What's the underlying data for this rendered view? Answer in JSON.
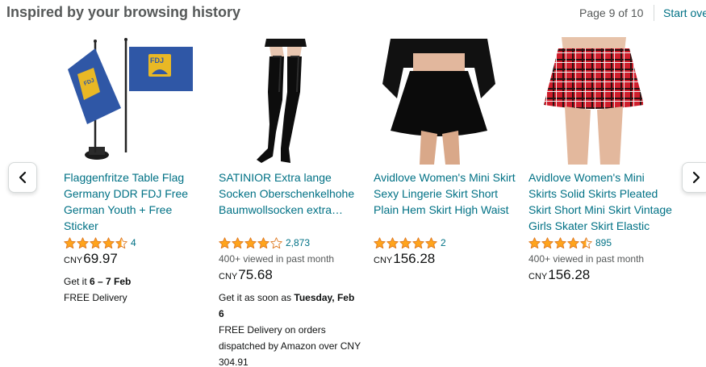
{
  "header": {
    "title": "Inspired by your browsing history",
    "page_indicator": "Page 9 of 10",
    "start_over": "Start over"
  },
  "icons": {
    "prev": "chevron-left-icon",
    "next": "chevron-right-icon",
    "star": "star-icon"
  },
  "colors": {
    "link": "#007185",
    "star": "#ffa41c",
    "text_secondary": "#565959"
  },
  "products": [
    {
      "name": "Flaggenfritze Table Flag Germany DDR FDJ Free German Youth + Free Sticker",
      "rating": 4.5,
      "rating_count": "4",
      "viewed": "",
      "currency": "CNY",
      "price": "69.97",
      "delivery_prefix": "Get it ",
      "delivery_date": "6 – 7 Feb",
      "delivery_note": "FREE Delivery"
    },
    {
      "name": "SATINIOR Extra lange Socken Oberschenkelhohe Baumwollsocken extra…",
      "rating": 4,
      "rating_count": "2,873",
      "viewed": "400+ viewed in past month",
      "currency": "CNY",
      "price": "75.68",
      "delivery_prefix": "Get it as soon as ",
      "delivery_date": "Tuesday, Feb 6",
      "delivery_note": "FREE Delivery on orders dispatched by Amazon over CNY 304.91"
    },
    {
      "name": "Avidlove Women's Mini Skirt Sexy Lingerie Skirt Short Plain Hem Skirt High Waist",
      "rating": 5,
      "rating_count": "2",
      "viewed": "",
      "currency": "CNY",
      "price": "156.28",
      "delivery_prefix": "",
      "delivery_date": "",
      "delivery_note": ""
    },
    {
      "name": "Avidlove Women's Mini Skirts Solid Skirts Pleated Skirt Short Mini Skirt Vintage Girls Skater Skirt Elastic Dress…",
      "rating": 4.5,
      "rating_count": "895",
      "viewed": "400+ viewed in past month",
      "currency": "CNY",
      "price": "156.28",
      "delivery_prefix": "",
      "delivery_date": "",
      "delivery_note": ""
    }
  ]
}
